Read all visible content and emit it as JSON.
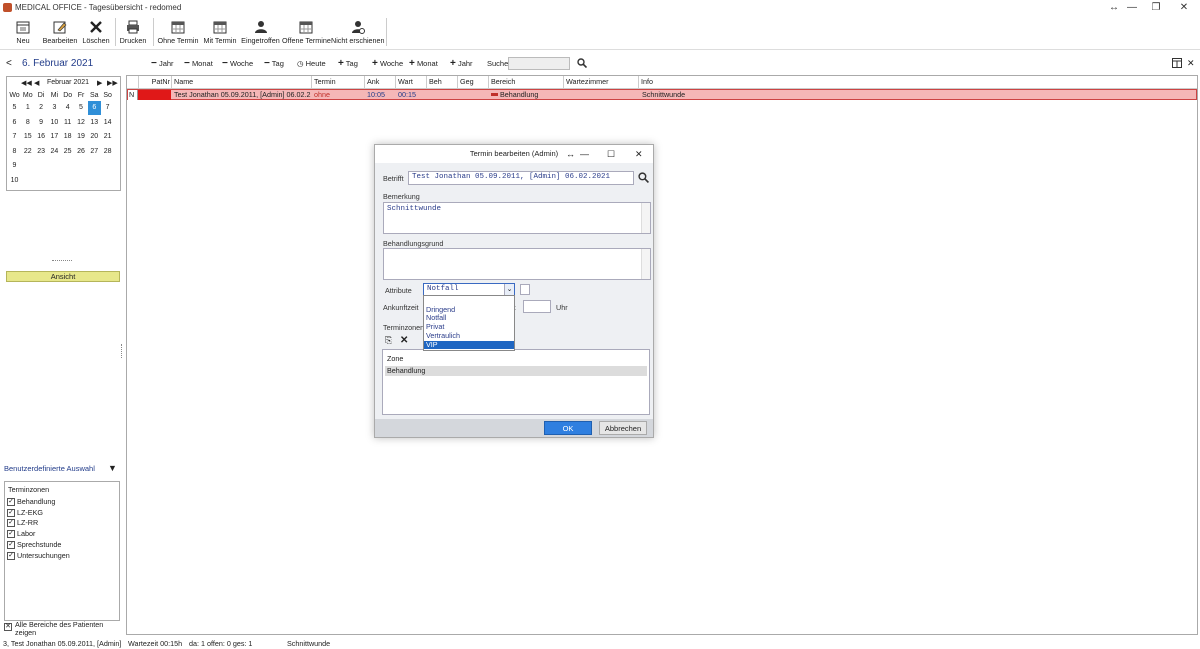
{
  "window": {
    "title": "MEDICAL OFFICE - Tagesübersicht - redomed",
    "controls": {
      "minimize": "—",
      "restore": "❐",
      "close": "✕",
      "resize": "↔"
    }
  },
  "toolbar": [
    {
      "label": "Neu",
      "icon": "new-doc-icon"
    },
    {
      "label": "Bearbeiten",
      "icon": "edit-icon"
    },
    {
      "label": "Löschen",
      "icon": "delete-icon"
    },
    {
      "label": "Drucken",
      "icon": "print-icon"
    },
    {
      "label": "Ohne Termin",
      "icon": "calendar-icon"
    },
    {
      "label": "Mit Termin",
      "icon": "calendar-icon"
    },
    {
      "label": "Eingetroffen",
      "icon": "person-icon"
    },
    {
      "label": "Offene Termine",
      "icon": "calendar-icon"
    },
    {
      "label": "Nicht erschienen",
      "icon": "person-icon"
    }
  ],
  "nav": {
    "prev": "<",
    "date": "6. Februar 2021",
    "buttons": [
      "Jahr",
      "Monat",
      "Woche",
      "Tag"
    ],
    "today": "Heute",
    "forward_buttons": [
      "Tag",
      "Woche",
      "Monat",
      "Jahr"
    ],
    "search_label": "Suche",
    "search_value": ""
  },
  "calendar": {
    "month": "Februar 2021",
    "header": [
      "Wo",
      "Mo",
      "Di",
      "Mi",
      "Do",
      "Fr",
      "Sa",
      "So"
    ],
    "weeks": [
      [
        "5",
        "1",
        "2",
        "3",
        "4",
        "5",
        "6",
        "7"
      ],
      [
        "6",
        "8",
        "9",
        "10",
        "11",
        "12",
        "13",
        "14"
      ],
      [
        "7",
        "15",
        "16",
        "17",
        "18",
        "19",
        "20",
        "21"
      ],
      [
        "8",
        "22",
        "23",
        "24",
        "25",
        "26",
        "27",
        "28"
      ],
      [
        "9",
        "",
        "",
        "",
        "",
        "",
        "",
        ""
      ],
      [
        "10",
        "",
        "",
        "",
        "",
        "",
        "",
        ""
      ]
    ],
    "selected": "6",
    "ansicht": "Ansicht"
  },
  "grid": {
    "columns": [
      "PatNr",
      "Name",
      "Termin",
      "Ank",
      "Wart",
      "Beh",
      "Geg",
      "Bereich",
      "Wartezimmer",
      "Info"
    ],
    "rows": [
      {
        "marker": "N",
        "patnr": "",
        "name": "Test Jonathan 05.09.2011, [Admin] 06.02.2",
        "termin": "ohne",
        "ank": "10:05",
        "wart": "00:15",
        "beh": "",
        "geg": "",
        "bereich": "Behandlung",
        "wartezimmer": "",
        "info": "Schnittwunde"
      }
    ]
  },
  "dialog": {
    "title": "Termin bearbeiten (Admin)",
    "betrifft_label": "Betrifft",
    "betrifft_value": "Test Jonathan 05.09.2011, [Admin] 06.02.2021",
    "bemerkung_label": "Bemerkung",
    "bemerkung_value": "Schnittwunde",
    "behandlungsgrund_label": "Behandlungsgrund",
    "behandlungsgrund_value": "",
    "attribute_label": "Attribute",
    "attribute_value": "Notfall",
    "ankunftzeit_label": "Ankunftzeit",
    "uhr_label": "Uhr",
    "partial_label": "it",
    "terminzonen_label": "Terminzonen",
    "dropdown_options": [
      "",
      "Dringend",
      "Notfall",
      "Privat",
      "Vertraulich",
      "VIP"
    ],
    "dropdown_selected": "VIP",
    "zone_header": "Zone",
    "zones": [
      "Behandlung"
    ],
    "ok": "OK",
    "cancel": "Abbrechen"
  },
  "left_bottom": {
    "title": "Benutzerdefinierte Auswahl",
    "group": "Terminzonen",
    "items": [
      "Behandlung",
      "LZ-EKG",
      "LZ-RR",
      "Labor",
      "Sprechstunde",
      "Untersuchungen"
    ],
    "footer": "Alle Bereiche des Patienten zeigen"
  },
  "status": {
    "patient": "3, Test Jonathan 05.09.2011, [Admin]",
    "wartezeit": "Wartezeit 00:15h",
    "counts": "da: 1 offen: 0 ges: 1",
    "info": "Schnittwunde"
  },
  "colors": {
    "row_bg": "#f5b7b7",
    "marker_red": "#e01818",
    "accent_blue": "#1f66c2",
    "ansicht_bg": "#e7e78a"
  }
}
